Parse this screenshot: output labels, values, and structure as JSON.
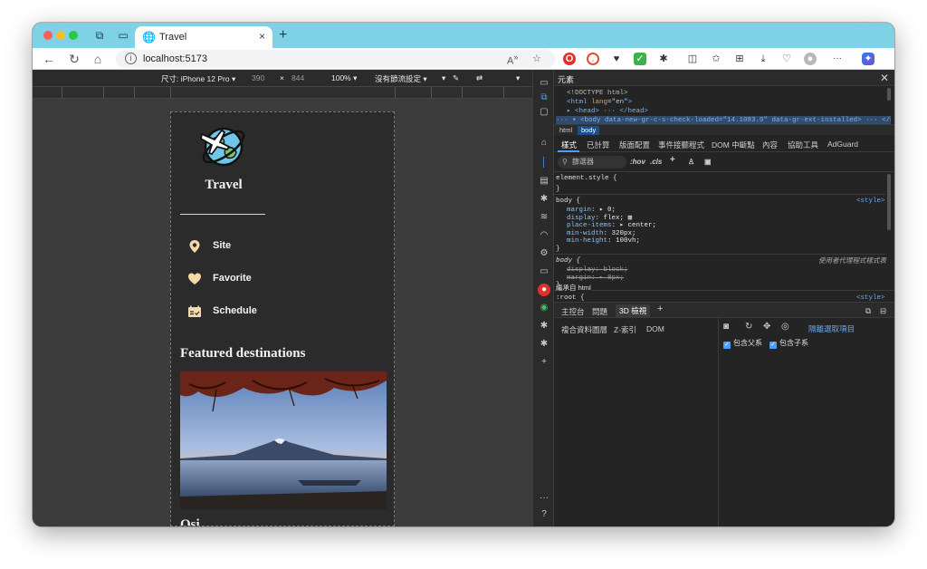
{
  "browser": {
    "tab": {
      "title": "Travel",
      "close": "×"
    },
    "new_tab": "+",
    "address": {
      "url": "localhost:5173",
      "info": "i"
    },
    "menu_dots": "···"
  },
  "device_toolbar": {
    "size_label": "尺寸: iPhone 12 Pro",
    "width": "390",
    "times": "×",
    "height": "844",
    "zoom": "100%",
    "throttle": "沒有節流設定"
  },
  "app": {
    "brand": "Travel",
    "menu": [
      {
        "label": "Site"
      },
      {
        "label": "Favorite"
      },
      {
        "label": "Schedule"
      }
    ],
    "section_title": "Featured destinations",
    "cut_text": "Osi"
  },
  "devtools": {
    "title": "元素",
    "dom": {
      "doctype": "<!DOCTYPE html>",
      "html_open": "<html",
      "lang_attr": "lang",
      "lang_val": "\"en\"",
      "head": "▸ <head> ··· </head>",
      "body_line": "··· ▾ <body data-new-gr-c-s-check-loaded=\"14.1083.0\" data-gr-ext-installed> ··· </body>"
    },
    "breadcrumbs": [
      "html",
      "body"
    ],
    "subtabs": [
      "樣式",
      "已計算",
      "版面配置",
      "事件接聽程式",
      "DOM 中斷點",
      "內容",
      "協助工具",
      "AdGuard"
    ],
    "filter_placeholder": "篩選器",
    "filter_hov": ":hov",
    "filter_cls": ".cls",
    "styles": {
      "element_style": "element.style {",
      "close_brace": "}",
      "body_sel": "body {",
      "source_style": "<style>",
      "props": [
        {
          "name": "margin",
          "value": "▸ 0;"
        },
        {
          "name": "display",
          "value": "flex;"
        },
        {
          "name": "place-items",
          "value": "▸ center;"
        },
        {
          "name": "min-width",
          "value": "320px;"
        },
        {
          "name": "min-height",
          "value": "100vh;"
        }
      ],
      "ua_sel": "body {",
      "ua_note": "使用者代理程式樣式表",
      "ua_props": [
        "display: block;",
        "margin: ▸ 8px;"
      ],
      "inherited": "繼承自 html",
      "root_sel": ":root {",
      "root_source": "<style>"
    },
    "drawer_tabs": [
      "主控台",
      "問題",
      "3D 檢視"
    ],
    "panel3d": {
      "tabs": [
        "複合資料圖層",
        "Z-索引",
        "DOM"
      ],
      "isolate_link": "隔離選取項目",
      "check_parent": "包含父系",
      "check_children": "包含子系"
    }
  }
}
